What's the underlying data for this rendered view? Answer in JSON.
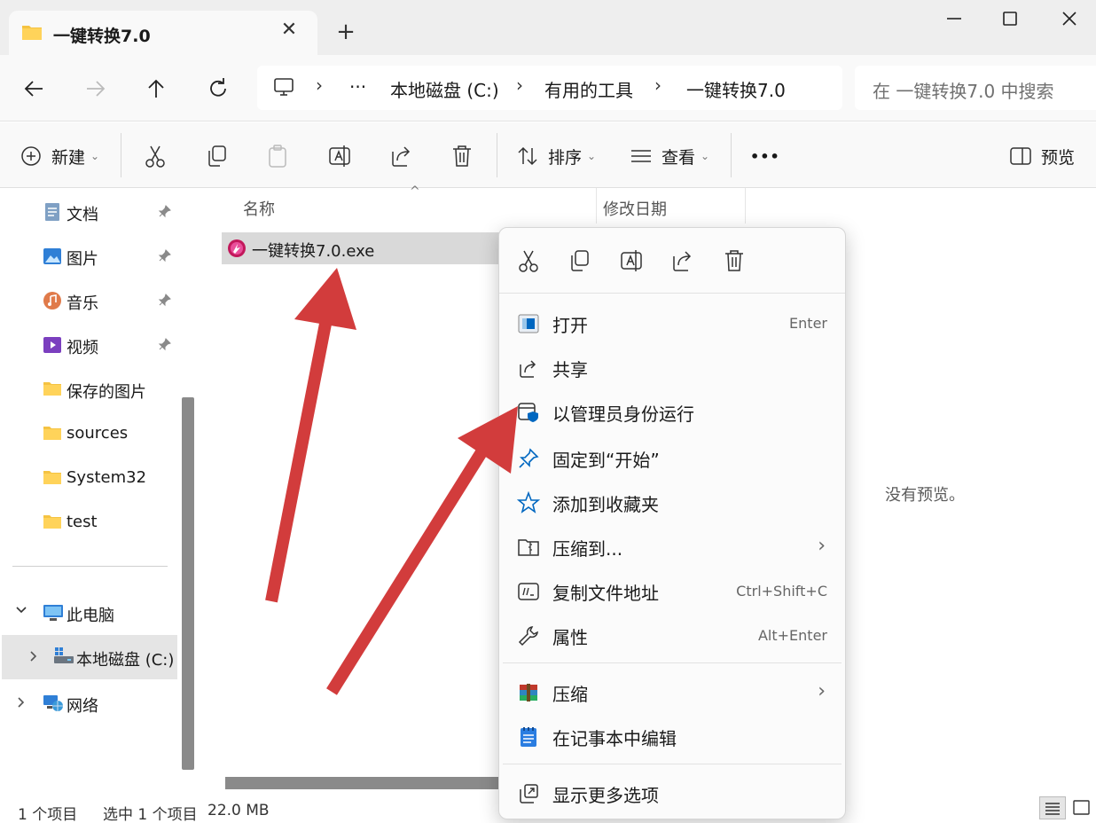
{
  "window": {
    "tab_title": "一键转换7.0",
    "new_tab_label": "+"
  },
  "address": {
    "ellipsis": "···",
    "crumbs": [
      "本地磁盘 (C:)",
      "有用的工具",
      "一键转换7.0"
    ],
    "search_placeholder": "在 一键转换7.0 中搜索"
  },
  "toolbar": {
    "new_label": "新建",
    "sort_label": "排序",
    "view_label": "查看",
    "more_label": "•••",
    "preview_label": "预览"
  },
  "sidebar": {
    "pinned": [
      {
        "label": "文档",
        "icon": "documents-icon"
      },
      {
        "label": "图片",
        "icon": "pictures-icon"
      },
      {
        "label": "音乐",
        "icon": "music-icon"
      },
      {
        "label": "视频",
        "icon": "videos-icon"
      }
    ],
    "folders": [
      "保存的图片",
      "sources",
      "System32",
      "test"
    ],
    "this_pc": "此电脑",
    "local_disk": "本地磁盘 (C:)",
    "network": "网络"
  },
  "main": {
    "columns": {
      "name": "名称",
      "modified": "修改日期"
    },
    "file_name": "一键转换7.0.exe",
    "no_preview": "没有预览。"
  },
  "status": {
    "item_count": "1 个项目",
    "selected": "选中 1 个项目",
    "size": "22.0 MB"
  },
  "context_menu": {
    "items": [
      {
        "label": "打开",
        "shortcut": "Enter"
      },
      {
        "label": "共享",
        "shortcut": ""
      },
      {
        "label": "以管理员身份运行",
        "shortcut": ""
      },
      {
        "label": "固定到“开始”",
        "shortcut": ""
      },
      {
        "label": "添加到收藏夹",
        "shortcut": ""
      },
      {
        "label": "压缩到...",
        "shortcut": ""
      },
      {
        "label": "复制文件地址",
        "shortcut": "Ctrl+Shift+C"
      },
      {
        "label": "属性",
        "shortcut": "Alt+Enter"
      },
      {
        "label": "压缩",
        "shortcut": ""
      },
      {
        "label": "在记事本中编辑",
        "shortcut": ""
      },
      {
        "label": "显示更多选项",
        "shortcut": ""
      }
    ]
  },
  "colors": {
    "accent": "#0067c0",
    "folder": "#f5c342",
    "annotation_arrow": "#d23c3c",
    "selection": "#d9d9d9"
  }
}
